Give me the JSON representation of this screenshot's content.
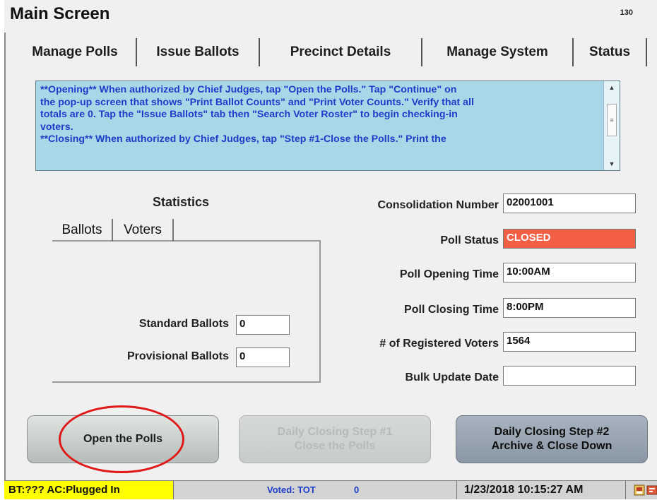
{
  "window": {
    "title": "Main Screen",
    "screen_number": "130"
  },
  "tabs": [
    {
      "label": "Manage Polls",
      "active": true
    },
    {
      "label": "Issue Ballots",
      "active": false
    },
    {
      "label": "Precinct Details",
      "active": false
    },
    {
      "label": "Manage System",
      "active": false
    },
    {
      "label": "Status",
      "active": false
    }
  ],
  "instructions": {
    "line1": "**Opening** When authorized by Chief Judges, tap \"Open the Polls.\"  Tap \"Continue\" on",
    "line2": "the pop-up screen that shows \"Print Ballot Counts\" and \"Print Voter Counts.\"  Verify that all",
    "line3": "totals are 0.  Tap the \"Issue Ballots\" tab then \"Search Voter Roster\" to begin checking-in",
    "line4": "voters.",
    "line5": "**Closing** When authorized by Chief Judges, tap \"Step #1-Close the Polls.\"  Print the"
  },
  "statistics": {
    "title": "Statistics",
    "tabs": [
      "Ballots",
      "Voters"
    ],
    "standard_ballots_label": "Standard Ballots",
    "standard_ballots_value": "0",
    "provisional_ballots_label": "Provisional Ballots",
    "provisional_ballots_value": "0"
  },
  "details": {
    "consolidation_label": "Consolidation Number",
    "consolidation_value": "02001001",
    "poll_status_label": "Poll Status",
    "poll_status_value": "CLOSED",
    "opening_label": "Poll Opening Time",
    "opening_value": "10:00AM",
    "closing_label": "Poll Closing Time",
    "closing_value": "8:00PM",
    "registered_label": "# of Registered Voters",
    "registered_value": "1564",
    "bulk_label": "Bulk Update Date",
    "bulk_value": ""
  },
  "buttons": {
    "open": "Open the Polls",
    "step1_line1": "Daily Closing Step #1",
    "step1_line2": "Close the Polls",
    "step2_line1": "Daily Closing Step #2",
    "step2_line2": "Archive & Close Down"
  },
  "status_bar": {
    "battery": "BT:??? AC:Plugged In",
    "voted_label": "Voted:  TOT",
    "voted_count": "0",
    "datetime": "1/23/2018 10:15:27 AM"
  },
  "colors": {
    "message_bg": "#a8d8e8",
    "message_text": "#1c3dc9",
    "poll_status_closed": "#f25f45",
    "battery_bg": "#ffff00",
    "highlight_circle": "#e01818"
  },
  "icons": {
    "scroll_up": "scroll-up-arrow-icon",
    "scroll_down": "scroll-down-arrow-icon",
    "tray_1": "printer-icon",
    "tray_2": "card-icon"
  }
}
